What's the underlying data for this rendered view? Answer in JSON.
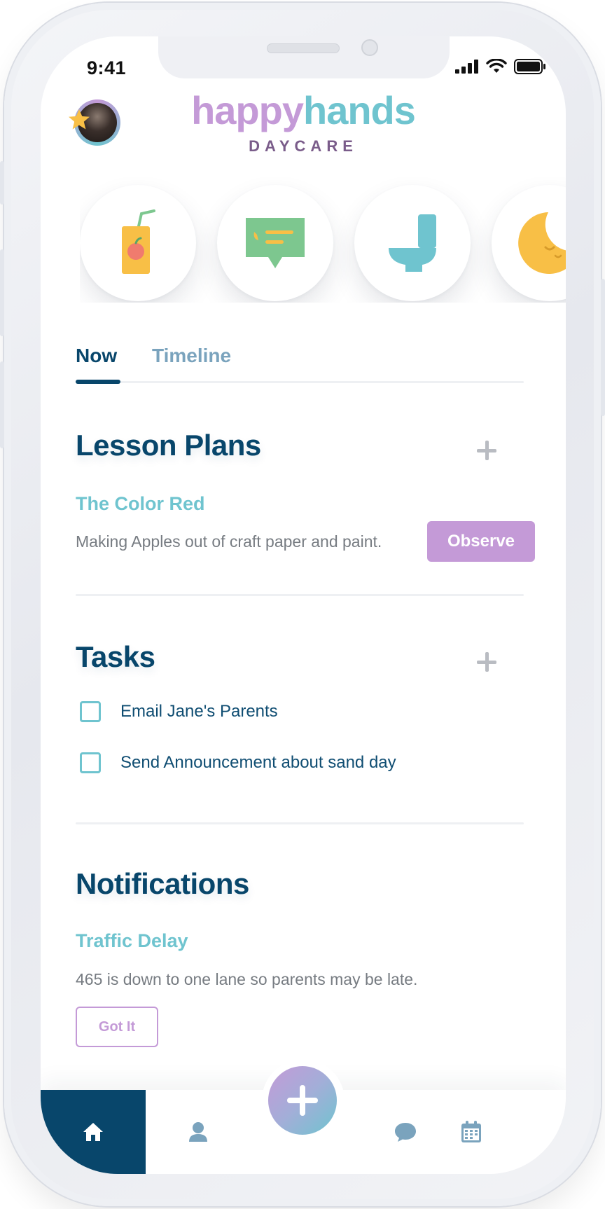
{
  "status_bar": {
    "time": "9:41"
  },
  "header": {
    "logo_part1": "happy",
    "logo_part2": "hands",
    "logo_sub": "DAYCARE"
  },
  "quick_actions": [
    {
      "icon": "juice-box-icon"
    },
    {
      "icon": "message-bubble-icon"
    },
    {
      "icon": "toilet-icon"
    },
    {
      "icon": "sleeping-moon-icon"
    }
  ],
  "tabs": [
    {
      "label": "Now",
      "active": true
    },
    {
      "label": "Timeline",
      "active": false
    }
  ],
  "lesson_plans": {
    "title": "Lesson Plans",
    "item_title": "The Color Red",
    "item_desc": "Making Apples out of craft paper and paint.",
    "button": "Observe"
  },
  "tasks": {
    "title": "Tasks",
    "items": [
      {
        "label": "Email Jane's Parents",
        "checked": false
      },
      {
        "label": "Send Announcement about sand day",
        "checked": false
      }
    ]
  },
  "notifications": {
    "title": "Notifications",
    "item_title": "Traffic Delay",
    "item_desc": "465 is down to one lane so parents may be late.",
    "button": "Got It"
  },
  "bottom_nav": [
    "home-icon",
    "profile-icon",
    "add-icon",
    "chat-icon",
    "calendar-icon"
  ],
  "colors": {
    "primary": "#08466b",
    "teal": "#6fc4cf",
    "purple": "#c49ad7",
    "muted": "#777c82"
  }
}
